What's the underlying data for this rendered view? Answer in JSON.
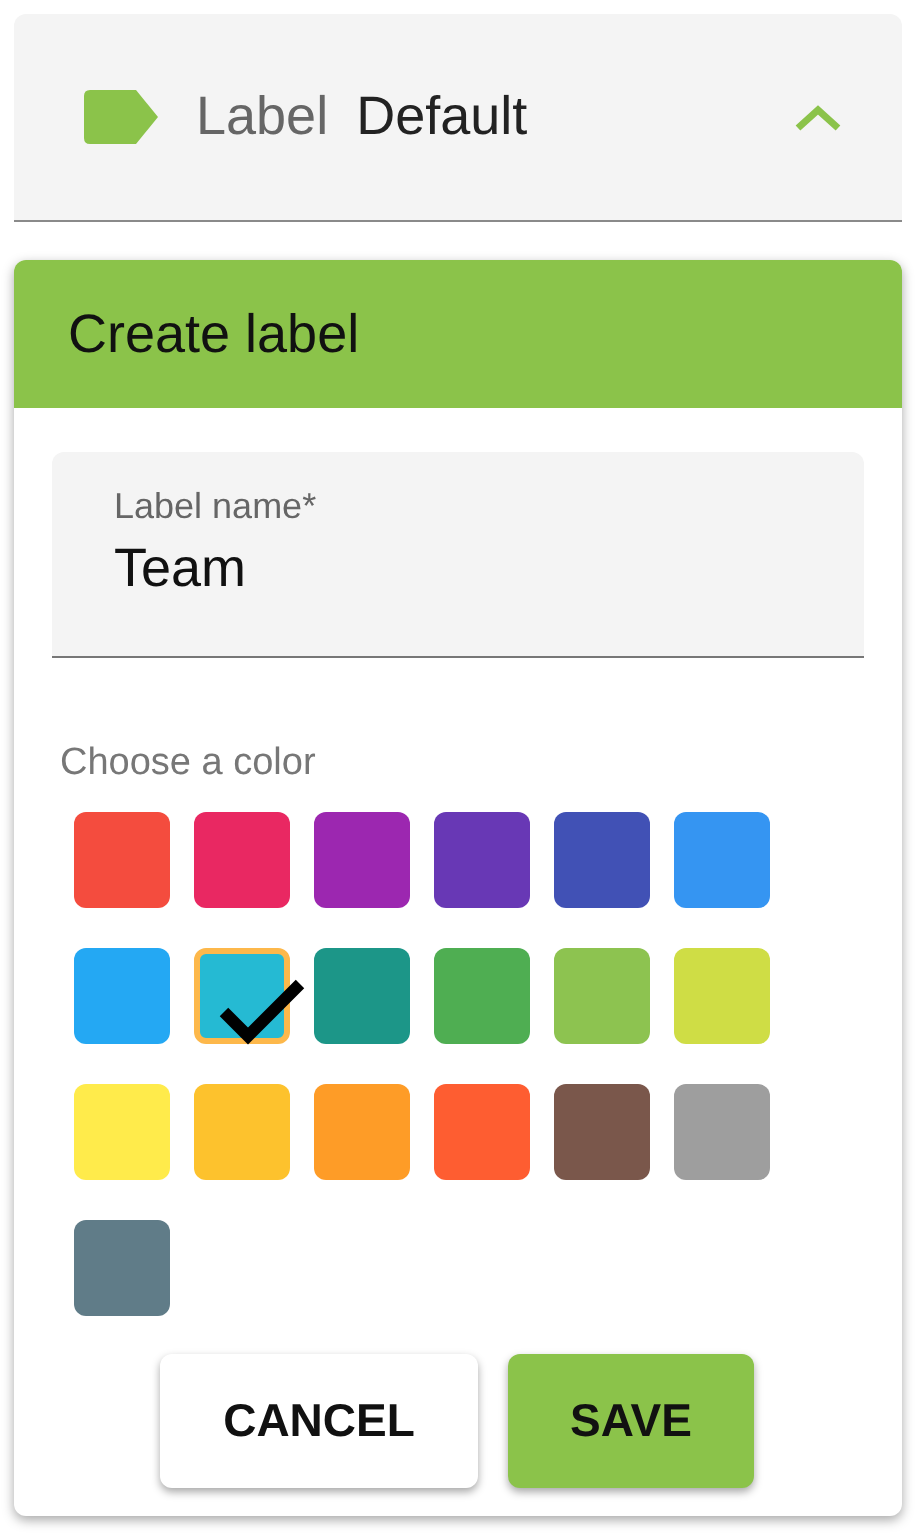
{
  "select": {
    "label": "Label",
    "value": "Default",
    "expanded": true
  },
  "dialog": {
    "title": "Create label",
    "name_field": {
      "label": "Label name*",
      "value": "Team"
    },
    "color_caption": "Choose a color",
    "swatches": [
      {
        "color": "#f44c3e",
        "selected": false
      },
      {
        "color": "#e92862",
        "selected": false
      },
      {
        "color": "#9c27b0",
        "selected": false
      },
      {
        "color": "#6838b5",
        "selected": false
      },
      {
        "color": "#4151b5",
        "selected": false
      },
      {
        "color": "#3595f2",
        "selected": false
      },
      {
        "color": "#24a8f3",
        "selected": false
      },
      {
        "color": "#25bad3",
        "selected": true
      },
      {
        "color": "#1c9688",
        "selected": false
      },
      {
        "color": "#4fae52",
        "selected": false
      },
      {
        "color": "#8dc350",
        "selected": false
      },
      {
        "color": "#cfdd45",
        "selected": false
      },
      {
        "color": "#ffeb4b",
        "selected": false
      },
      {
        "color": "#fdc22d",
        "selected": false
      },
      {
        "color": "#fe9c27",
        "selected": false
      },
      {
        "color": "#fe5d31",
        "selected": false
      },
      {
        "color": "#7a574b",
        "selected": false
      },
      {
        "color": "#9e9e9e",
        "selected": false
      },
      {
        "color": "#607c88",
        "selected": false
      }
    ],
    "buttons": [
      {
        "label": "CANCEL",
        "kind": "secondary"
      },
      {
        "label": "SAVE",
        "kind": "primary"
      }
    ]
  }
}
